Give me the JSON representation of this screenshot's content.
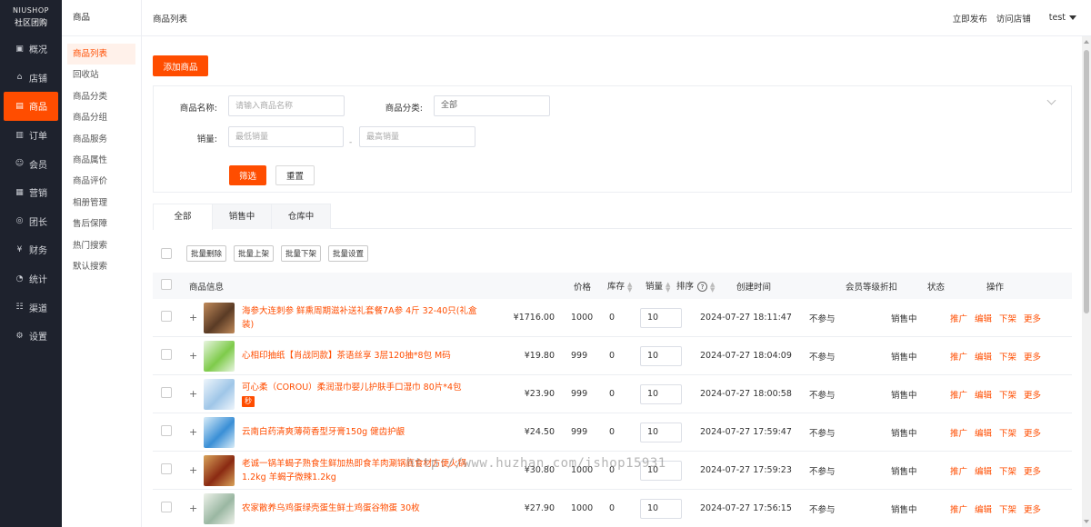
{
  "brand": {
    "line1": "NIUSHOP",
    "line2": "社区团购"
  },
  "nav": [
    {
      "label": "概况",
      "icon": "dashboard-icon",
      "glyph": "▣"
    },
    {
      "label": "店铺",
      "icon": "store-icon",
      "glyph": "⌂"
    },
    {
      "label": "商品",
      "icon": "goods-icon",
      "glyph": "▤",
      "active": true
    },
    {
      "label": "订单",
      "icon": "order-icon",
      "glyph": "▥"
    },
    {
      "label": "会员",
      "icon": "member-icon",
      "glyph": "☺"
    },
    {
      "label": "营销",
      "icon": "marketing-icon",
      "glyph": "▦"
    },
    {
      "label": "团长",
      "icon": "leader-icon",
      "glyph": "◎"
    },
    {
      "label": "财务",
      "icon": "finance-icon",
      "glyph": "¥"
    },
    {
      "label": "统计",
      "icon": "stats-icon",
      "glyph": "◔"
    },
    {
      "label": "渠道",
      "icon": "channel-icon",
      "glyph": "☷"
    },
    {
      "label": "设置",
      "icon": "settings-icon",
      "glyph": "⚙"
    }
  ],
  "subnav": {
    "title": "商品",
    "items": [
      {
        "label": "商品列表",
        "active": true
      },
      {
        "label": "回收站"
      },
      {
        "label": "商品分类"
      },
      {
        "label": "商品分组"
      },
      {
        "label": "商品服务"
      },
      {
        "label": "商品属性"
      },
      {
        "label": "商品评价"
      },
      {
        "label": "相册管理"
      },
      {
        "label": "售后保障"
      },
      {
        "label": "热门搜索"
      },
      {
        "label": "默认搜索"
      }
    ]
  },
  "topbar": {
    "breadcrumb": "商品列表",
    "publish": "立即发布",
    "visit": "访问店铺",
    "user": "test"
  },
  "add_button": "添加商品",
  "filter": {
    "name_label": "商品名称:",
    "name_placeholder": "请输入商品名称",
    "category_label": "商品分类:",
    "category_value": "全部",
    "sales_label": "销量:",
    "sales_min_placeholder": "最低销量",
    "sales_max_placeholder": "最高销量",
    "dash": "-",
    "search_button": "筛选",
    "reset_button": "重置"
  },
  "tabs": [
    {
      "label": "全部",
      "active": true
    },
    {
      "label": "销售中"
    },
    {
      "label": "仓库中"
    }
  ],
  "batch": [
    "批量删除",
    "批量上架",
    "批量下架",
    "批量设置"
  ],
  "table": {
    "headers": {
      "info": "商品信息",
      "price": "价格",
      "stock": "库存",
      "sales": "销量",
      "sort": "排序",
      "time": "创建时间",
      "discount": "会员等级折扣",
      "status": "状态",
      "ops": "操作"
    },
    "ops": [
      "推广",
      "编辑",
      "下架",
      "更多"
    ],
    "rows": [
      {
        "name": "海参大连刺参 鲜熏周期滋补送礼套餐7A参 4斤 32-40只(礼盒装)",
        "price": "¥1716.00",
        "stock": "1000",
        "sales": "0",
        "sort": "10",
        "time": "2024-07-27 18:11:47",
        "discount": "不参与",
        "status": "销售中",
        "thumb": "#5a3b25",
        "thumb2": "#c08a5a"
      },
      {
        "name": "心相印抽纸【肖战同款】茶语丝享 3层120抽*8包 M码",
        "price": "¥19.80",
        "stock": "999",
        "sales": "0",
        "sort": "10",
        "time": "2024-07-27 18:04:09",
        "discount": "不参与",
        "status": "销售中",
        "thumb": "#7ecb4a",
        "thumb2": "#e8f5e0"
      },
      {
        "name": "可心柔（COROU）柔润湿巾婴儿护肤手口湿巾 80片*4包",
        "tag": "秒",
        "price": "¥23.90",
        "stock": "999",
        "sales": "0",
        "sort": "10",
        "time": "2024-07-27 18:00:58",
        "discount": "不参与",
        "status": "销售中",
        "thumb": "#9fc6e8",
        "thumb2": "#eef5fb"
      },
      {
        "name": "云南白药清爽薄荷香型牙膏150g 健齿护龈",
        "price": "¥24.50",
        "stock": "999",
        "sales": "0",
        "sort": "10",
        "time": "2024-07-27 17:59:47",
        "discount": "不参与",
        "status": "销售中",
        "thumb": "#3a8fd6",
        "thumb2": "#d8ecf8"
      },
      {
        "name": "老诚一锅羊蝎子熟食生鲜加热即食羊肉涮锅底食材方便火锅1.2kg 羊蝎子微辣1.2kg",
        "price": "¥30.80",
        "stock": "1000",
        "sales": "0",
        "sort": "10",
        "time": "2024-07-27 17:59:23",
        "discount": "不参与",
        "status": "销售中",
        "thumb": "#8a2a12",
        "thumb2": "#d9a35a"
      },
      {
        "name": "农家散养乌鸡蛋绿壳蛋生鲜土鸡蛋谷物蛋 30枚",
        "price": "¥27.90",
        "stock": "1000",
        "sales": "0",
        "sort": "10",
        "time": "2024-07-27 17:56:15",
        "discount": "不参与",
        "status": "销售中",
        "thumb": "#9ab7a2",
        "thumb2": "#eef2ea"
      }
    ]
  },
  "watermark": "http://www.huzhan.com/ishop15931"
}
